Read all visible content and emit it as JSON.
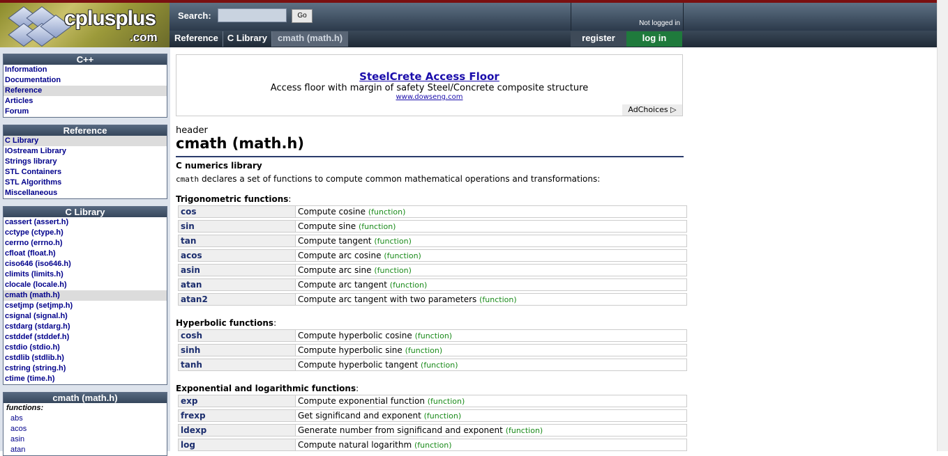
{
  "header": {
    "logo_text": "cplusplus",
    "logo_suffix": ".com",
    "search_label": "Search:",
    "search_placeholder": "",
    "go_label": "Go",
    "breadcrumb": [
      "Reference",
      "C Library",
      "cmath (math.h)"
    ],
    "login_status": "Not logged in",
    "register_label": "register",
    "login_label": "log in"
  },
  "sidebar": {
    "cpp": {
      "title": "C++",
      "items": [
        "Information",
        "Documentation",
        "Reference",
        "Articles",
        "Forum"
      ],
      "selected_index": 2
    },
    "reference": {
      "title": "Reference",
      "items": [
        "C Library",
        "IOstream Library",
        "Strings library",
        "STL Containers",
        "STL Algorithms",
        "Miscellaneous"
      ],
      "selected_index": 0
    },
    "clibrary": {
      "title": "C Library",
      "items": [
        "cassert (assert.h)",
        "cctype (ctype.h)",
        "cerrno (errno.h)",
        "cfloat (float.h)",
        "ciso646 (iso646.h)",
        "climits (limits.h)",
        "clocale (locale.h)",
        "cmath (math.h)",
        "csetjmp (setjmp.h)",
        "csignal (signal.h)",
        "cstdarg (stdarg.h)",
        "cstddef (stddef.h)",
        "cstdio (stdio.h)",
        "cstdlib (stdlib.h)",
        "cstring (string.h)",
        "ctime (time.h)"
      ],
      "selected_index": 7
    },
    "cmath": {
      "title": "cmath (math.h)",
      "functions_label": "functions:",
      "items": [
        "abs",
        "acos",
        "asin",
        "atan"
      ]
    }
  },
  "ad": {
    "title": "SteelCrete Access Floor",
    "description": "Access floor with margin of safety Steel/Concrete composite structure",
    "url": "www.dowseng.com",
    "adchoices": "AdChoices"
  },
  "main": {
    "kind": "header",
    "title": "cmath (math.h)",
    "subtitle": "C numerics library",
    "intro_code": "cmath",
    "intro_text": " declares a set of functions to compute common mathematical operations and transformations:",
    "function_tag": "(function)",
    "sections": [
      {
        "title": "Trigonometric functions",
        "rows": [
          {
            "name": "cos",
            "desc": "Compute cosine"
          },
          {
            "name": "sin",
            "desc": "Compute sine"
          },
          {
            "name": "tan",
            "desc": "Compute tangent"
          },
          {
            "name": "acos",
            "desc": "Compute arc cosine"
          },
          {
            "name": "asin",
            "desc": "Compute arc sine"
          },
          {
            "name": "atan",
            "desc": "Compute arc tangent"
          },
          {
            "name": "atan2",
            "desc": "Compute arc tangent with two parameters"
          }
        ]
      },
      {
        "title": "Hyperbolic functions",
        "rows": [
          {
            "name": "cosh",
            "desc": "Compute hyperbolic cosine"
          },
          {
            "name": "sinh",
            "desc": "Compute hyperbolic sine"
          },
          {
            "name": "tanh",
            "desc": "Compute hyperbolic tangent"
          }
        ]
      },
      {
        "title": "Exponential and logarithmic functions",
        "rows": [
          {
            "name": "exp",
            "desc": "Compute exponential function"
          },
          {
            "name": "frexp",
            "desc": "Get significand and exponent"
          },
          {
            "name": "ldexp",
            "desc": "Generate number from significand and exponent"
          },
          {
            "name": "log",
            "desc": "Compute natural logarithm"
          }
        ]
      }
    ]
  },
  "colors": {
    "link": "#00008b",
    "function_tag": "#198a19",
    "login_button": "#1f7a3c"
  }
}
